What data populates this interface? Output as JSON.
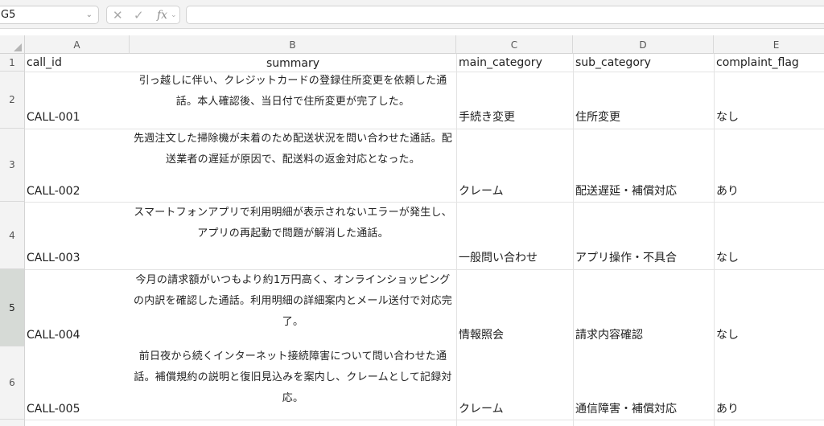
{
  "formula_bar": {
    "cell_reference": "G5",
    "cancel_icon": "close-icon",
    "accept_icon": "check-icon",
    "function_label": "fx",
    "formula_value": ""
  },
  "columns": [
    "A",
    "B",
    "C",
    "D",
    "E"
  ],
  "rows": [
    "1",
    "2",
    "3",
    "4",
    "5",
    "6"
  ],
  "selected_row": "5",
  "headers": {
    "a": "call_id",
    "b": "summary",
    "c": "main_category",
    "d": "sub_category",
    "e": "complaint_flag"
  },
  "records": [
    {
      "call_id": "CALL-001",
      "summary": "引っ越しに伴い、クレジットカードの登録住所変更を依頼した通話。本人確認後、当日付で住所変更が完了した。",
      "main_category": "手続き変更",
      "sub_category": "住所変更",
      "complaint_flag": "なし"
    },
    {
      "call_id": "CALL-002",
      "summary": "先週注文した掃除機が未着のため配送状況を問い合わせた通話。配送業者の遅延が原因で、配送料の返金対応となった。",
      "main_category": "クレーム",
      "sub_category": "配送遅延・補償対応",
      "complaint_flag": "あり"
    },
    {
      "call_id": "CALL-003",
      "summary": "スマートフォンアプリで利用明細が表示されないエラーが発生し、アプリの再起動で問題が解消した通話。",
      "main_category": "一般問い合わせ",
      "sub_category": "アプリ操作・不具合",
      "complaint_flag": "なし"
    },
    {
      "call_id": "CALL-004",
      "summary": "今月の請求額がいつもより約1万円高く、オンラインショッピングの内訳を確認した通話。利用明細の詳細案内とメール送付で対応完了。",
      "main_category": "情報照会",
      "sub_category": "請求内容確認",
      "complaint_flag": "なし"
    },
    {
      "call_id": "CALL-005",
      "summary": "前日夜から続くインターネット接続障害について問い合わせた通話。補償規約の説明と復旧見込みを案内し、クレームとして記録対応。",
      "main_category": "クレーム",
      "sub_category": "通信障害・補償対応",
      "complaint_flag": "あり"
    }
  ]
}
